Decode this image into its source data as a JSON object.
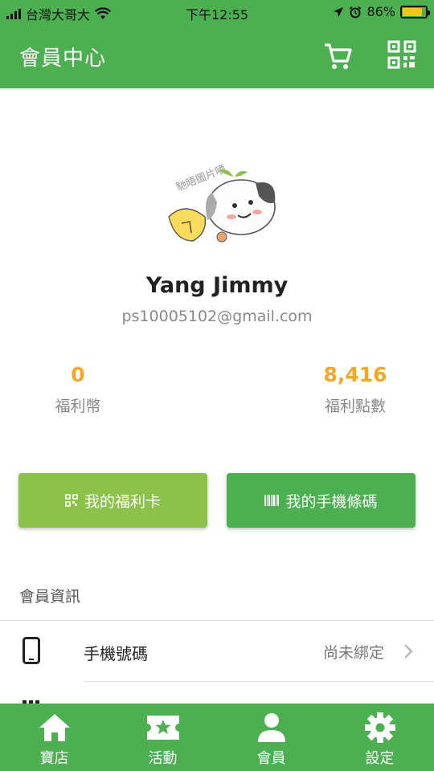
{
  "status_bar": {
    "carrier": "台灣大哥大",
    "time": "下午12:55",
    "battery": "86%",
    "battery_level": 0.86
  },
  "app_bar": {
    "title": "會員中心",
    "cart_icon": "shopping-cart-icon",
    "qr_icon": "qr-code-icon"
  },
  "profile": {
    "name": "Yang Jimmy",
    "email": "ps10005102@gmail.com",
    "avatar_watermark": "馳晤圖片哂"
  },
  "stats": [
    {
      "value": "0",
      "label": "福利幣"
    },
    {
      "value": "8,416",
      "label": "福利點數"
    }
  ],
  "buttons": {
    "welfare_card": "我的福利卡",
    "mobile_barcode": "我的手機條碼"
  },
  "member_info": {
    "section_title": "會員資訊",
    "rows": [
      {
        "label": "手機號碼",
        "value": "尚未綁定",
        "icon": "smartphone-icon"
      }
    ]
  },
  "bottom_nav": [
    {
      "label": "寶店",
      "icon": "home-icon"
    },
    {
      "label": "活動",
      "icon": "ticket-star-icon"
    },
    {
      "label": "會員",
      "icon": "person-icon"
    },
    {
      "label": "設定",
      "icon": "gear-icon"
    }
  ],
  "colors": {
    "primary": "#4caf50",
    "light_green": "#8bc34a",
    "accent_orange": "#f5a623"
  }
}
